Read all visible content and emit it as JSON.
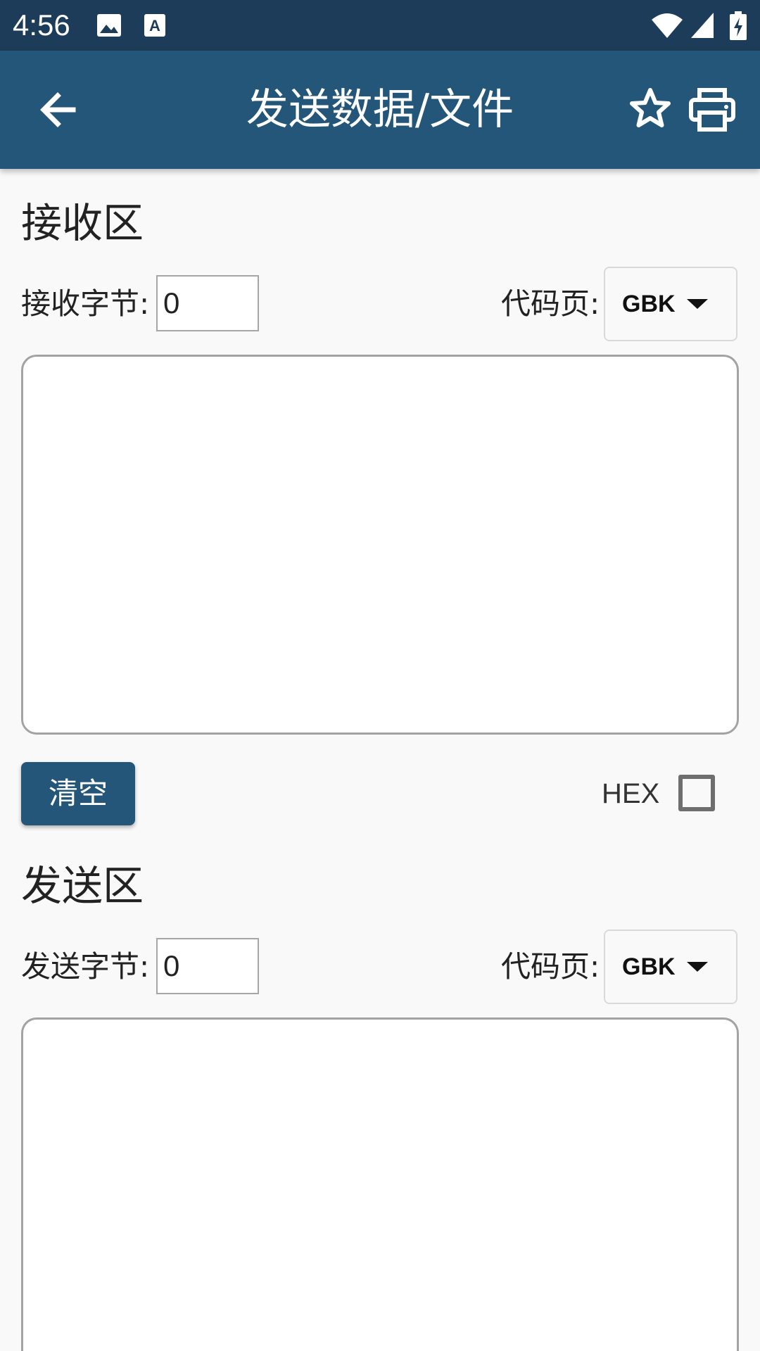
{
  "status_bar": {
    "time": "4:56",
    "icons": [
      "image-icon",
      "text-notification-icon",
      "wifi-icon",
      "signal-icon",
      "battery-charging-icon"
    ]
  },
  "app_bar": {
    "title": "发送数据/文件",
    "back_icon": "arrow-left-icon",
    "actions": [
      "star-icon",
      "printer-icon"
    ],
    "color": "#235678"
  },
  "receive": {
    "section_title": "接收区",
    "bytes_label": "接收字节:",
    "bytes_value": "0",
    "codepage_label": "代码页:",
    "codepage_value": "GBK",
    "text": ""
  },
  "controls": {
    "clear_label": "清空",
    "hex_label": "HEX",
    "hex_checked": false
  },
  "send": {
    "section_title": "发送区",
    "bytes_label": "发送字节:",
    "bytes_value": "0",
    "codepage_label": "代码页:",
    "codepage_value": "GBK",
    "text": ""
  }
}
